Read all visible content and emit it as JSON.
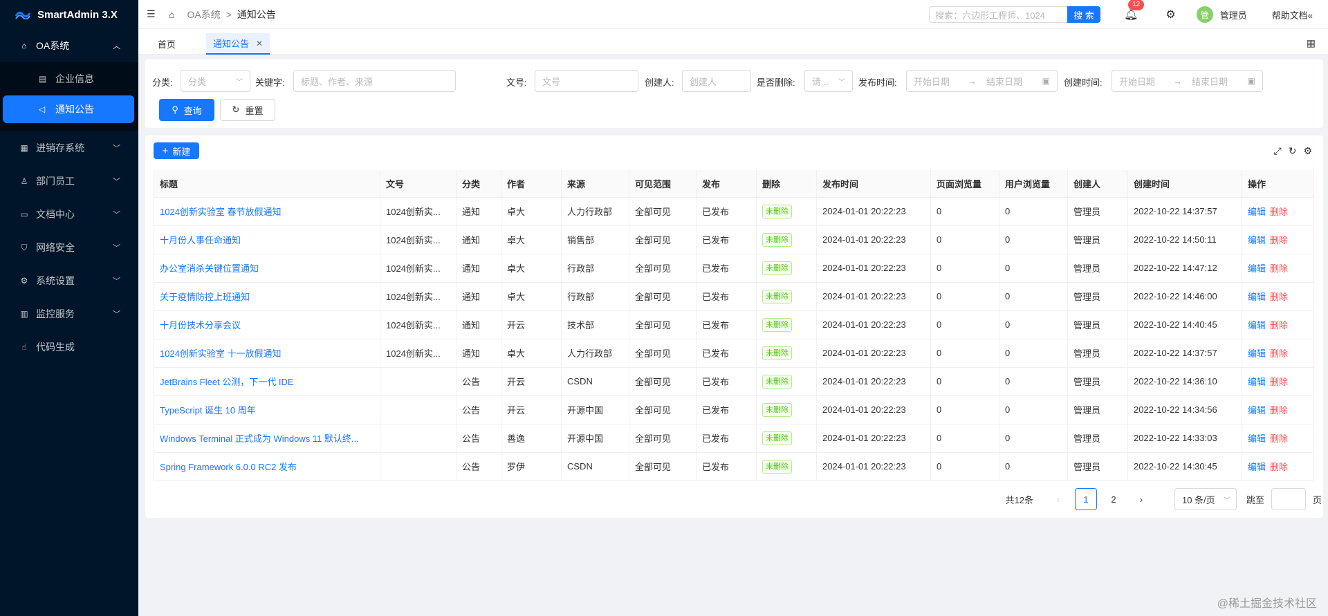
{
  "app": {
    "title": "SmartAdmin 3.X"
  },
  "sidebar": {
    "items": [
      {
        "label": "OA系统",
        "icon": "bank-icon",
        "open": true
      },
      {
        "label": "进销存系统",
        "icon": "table-icon"
      },
      {
        "label": "部门员工",
        "icon": "user-icon"
      },
      {
        "label": "文档中心",
        "icon": "file-icon"
      },
      {
        "label": "网络安全",
        "icon": "shield-icon"
      },
      {
        "label": "系统设置",
        "icon": "setting-icon"
      },
      {
        "label": "监控服务",
        "icon": "chart-icon"
      },
      {
        "label": "代码生成",
        "icon": "code-icon"
      }
    ],
    "sub_items": [
      {
        "label": "企业信息",
        "active": false
      },
      {
        "label": "通知公告",
        "active": true
      }
    ]
  },
  "header": {
    "breadcrumb": [
      "OA系统",
      "通知公告"
    ],
    "search_placeholder": "搜索：六边形工程师、1024",
    "search_button": "搜 索",
    "notify_count": "12",
    "avatar_text": "管",
    "user_name": "管理员",
    "help": "帮助文档«"
  },
  "tabs": [
    {
      "label": "首页"
    },
    {
      "label": "通知公告",
      "active": true
    }
  ],
  "filter": {
    "category_label": "分类:",
    "category_placeholder": "分类",
    "keyword_label": "关键字:",
    "keyword_placeholder": "标题、作者、来源",
    "docno_label": "文号:",
    "docno_placeholder": "文号",
    "creator_label": "创建人:",
    "creator_placeholder": "创建人",
    "deleted_label": "是否删除:",
    "deleted_placeholder": "请...",
    "publish_label": "发布时间:",
    "create_label": "创建时间:",
    "start_date": "开始日期",
    "end_date": "结束日期",
    "query_button": "查询",
    "reset_button": "重置"
  },
  "table": {
    "new_button": "新建",
    "columns": [
      "标题",
      "文号",
      "分类",
      "作者",
      "来源",
      "可见范围",
      "发布",
      "删除",
      "发布时间",
      "页面浏览量",
      "用户浏览量",
      "创建人",
      "创建时间",
      "操作"
    ],
    "edit_label": "编辑",
    "delete_label": "删除",
    "rows": [
      {
        "title": "1024创新实验室 春节放假通知",
        "docno": "1024创新实...",
        "category": "通知",
        "author": "卓大",
        "source": "人力行政部",
        "visible": "全部可见",
        "publish": "已发布",
        "deleted": "未删除",
        "publish_time": "2024-01-01 20:22:23",
        "page_views": "0",
        "user_views": "0",
        "creator": "管理员",
        "create_time": "2022-10-22 14:37:57"
      },
      {
        "title": "十月份人事任命通知",
        "docno": "1024创新实...",
        "category": "通知",
        "author": "卓大",
        "source": "销售部",
        "visible": "全部可见",
        "publish": "已发布",
        "deleted": "未删除",
        "publish_time": "2024-01-01 20:22:23",
        "page_views": "0",
        "user_views": "0",
        "creator": "管理员",
        "create_time": "2022-10-22 14:50:11"
      },
      {
        "title": "办公室消杀关键位置通知",
        "docno": "1024创新实...",
        "category": "通知",
        "author": "卓大",
        "source": "行政部",
        "visible": "全部可见",
        "publish": "已发布",
        "deleted": "未删除",
        "publish_time": "2024-01-01 20:22:23",
        "page_views": "0",
        "user_views": "0",
        "creator": "管理员",
        "create_time": "2022-10-22 14:47:12"
      },
      {
        "title": "关于疫情防控上班通知",
        "docno": "1024创新实...",
        "category": "通知",
        "author": "卓大",
        "source": "行政部",
        "visible": "全部可见",
        "publish": "已发布",
        "deleted": "未删除",
        "publish_time": "2024-01-01 20:22:23",
        "page_views": "0",
        "user_views": "0",
        "creator": "管理员",
        "create_time": "2022-10-22 14:46:00"
      },
      {
        "title": "十月份技术分享会议",
        "docno": "1024创新实...",
        "category": "通知",
        "author": "开云",
        "source": "技术部",
        "visible": "全部可见",
        "publish": "已发布",
        "deleted": "未删除",
        "publish_time": "2024-01-01 20:22:23",
        "page_views": "0",
        "user_views": "0",
        "creator": "管理员",
        "create_time": "2022-10-22 14:40:45"
      },
      {
        "title": "1024创新实验室 十一放假通知",
        "docno": "1024创新实...",
        "category": "通知",
        "author": "卓大",
        "source": "人力行政部",
        "visible": "全部可见",
        "publish": "已发布",
        "deleted": "未删除",
        "publish_time": "2024-01-01 20:22:23",
        "page_views": "0",
        "user_views": "0",
        "creator": "管理员",
        "create_time": "2022-10-22 14:37:57"
      },
      {
        "title": "JetBrains Fleet 公测，下一代 IDE",
        "docno": "",
        "category": "公告",
        "author": "开云",
        "source": "CSDN",
        "visible": "全部可见",
        "publish": "已发布",
        "deleted": "未删除",
        "publish_time": "2024-01-01 20:22:23",
        "page_views": "0",
        "user_views": "0",
        "creator": "管理员",
        "create_time": "2022-10-22 14:36:10"
      },
      {
        "title": "TypeScript 诞生 10 周年",
        "docno": "",
        "category": "公告",
        "author": "开云",
        "source": "开源中国",
        "visible": "全部可见",
        "publish": "已发布",
        "deleted": "未删除",
        "publish_time": "2024-01-01 20:22:23",
        "page_views": "0",
        "user_views": "0",
        "creator": "管理员",
        "create_time": "2022-10-22 14:34:56"
      },
      {
        "title": "Windows Terminal 正式成为 Windows 11 默认终...",
        "docno": "",
        "category": "公告",
        "author": "善逸",
        "source": "开源中国",
        "visible": "全部可见",
        "publish": "已发布",
        "deleted": "未删除",
        "publish_time": "2024-01-01 20:22:23",
        "page_views": "0",
        "user_views": "0",
        "creator": "管理员",
        "create_time": "2022-10-22 14:33:03"
      },
      {
        "title": "Spring Framework 6.0.0 RC2 发布",
        "docno": "",
        "category": "公告",
        "author": "罗伊",
        "source": "CSDN",
        "visible": "全部可见",
        "publish": "已发布",
        "deleted": "未删除",
        "publish_time": "2024-01-01 20:22:23",
        "page_views": "0",
        "user_views": "0",
        "creator": "管理员",
        "create_time": "2022-10-22 14:30:45"
      }
    ]
  },
  "pagination": {
    "total": "共12条",
    "pages": [
      "1",
      "2"
    ],
    "current": "1",
    "page_size": "10 条/页",
    "jump_label": "跳至",
    "page_suffix": "页"
  },
  "footer_mark": "@稀土掘金技术社区",
  "colors": {
    "primary": "#1677ff",
    "danger": "#ff4d4f",
    "sidebar_bg": "#001529",
    "success": "#52c41a"
  }
}
